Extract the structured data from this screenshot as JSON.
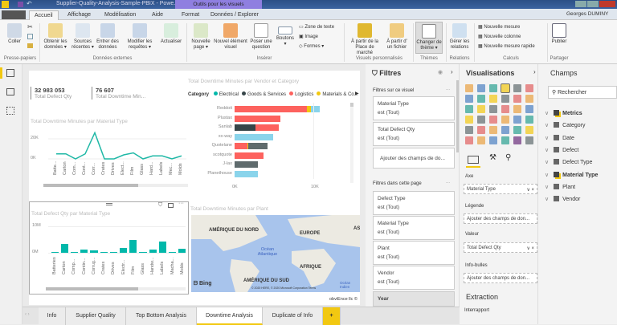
{
  "window": {
    "title": "Supplier-Quality-Analysis-Sample-PBIX - Powe...",
    "context_tab": "Outils pour les visuels",
    "user": "Georges DUMINY"
  },
  "ribbon_tabs": [
    "Accueil",
    "Affichage",
    "Modélisation",
    "Aide",
    "Format",
    "Données / Explorer"
  ],
  "ribbon": {
    "paste": "Coller",
    "clipboard_group": "Presse-papiers",
    "get_data": "Obtenir les données ▾",
    "recent": "Sources récentes ▾",
    "enter": "Entrer des données",
    "edit_queries": "Modifier les requêtes ▾",
    "refresh": "Actualiser",
    "external_group": "Données externes",
    "new_page": "Nouvelle page ▾",
    "new_visual": "Nouvel élément visuel",
    "ask": "Poser une question",
    "buttons": "Boutons ▾",
    "textbox": "Zone de texte",
    "image": "Image",
    "shapes": "Formes ▾",
    "insert_group": "Insérer",
    "marketplace": "À partir de la Place de marché",
    "from_file": "À partir d' un fichier",
    "custom_group": "Visuels personnalisés",
    "theme": "Changer de thème ▾",
    "themes_group": "Thèmes",
    "relations": "Gérer les relations",
    "relations_group": "Relations",
    "new_measure": "Nouvelle mesure",
    "new_column": "Nouvelle colonne",
    "quick_measure": "Nouvelle mesure rapide",
    "calc_group": "Calculs",
    "publish": "Publier",
    "share_group": "Partager"
  },
  "kpis": [
    {
      "value": "32 983 053",
      "label": "Total Defect Qty"
    },
    {
      "value": "76 607",
      "label": "Total Downtime Min..."
    }
  ],
  "chart_data": [
    {
      "type": "line",
      "title": "Total Downtime Minutes par Material Type",
      "categories": [
        "Batte...",
        "Carton",
        "Com...",
        "Cont...",
        "Corr...",
        "Crates",
        "Drives",
        "Elect...",
        "Film",
        "Glass",
        "Hard...",
        "Labels",
        "Mec...",
        "Molds"
      ],
      "values": [
        5000,
        5000,
        0,
        5000,
        26000,
        0,
        0,
        4000,
        6000,
        0,
        3000,
        3000,
        0,
        3000
      ],
      "yticks": [
        "0K",
        "20K"
      ],
      "ylim": [
        0,
        28000
      ],
      "color": "#1fb8a6"
    },
    {
      "type": "bar",
      "stacked": true,
      "orientation": "horizontal",
      "title": "Total Downtime Minutes par Vendor et Category",
      "legend_title": "Category",
      "legend": "top",
      "categories": [
        "Reddoit",
        "Plustax",
        "Sanlab",
        "xx-way",
        "Quotelane",
        "scotquote",
        "J-lax",
        "Planethouse"
      ],
      "series": [
        {
          "name": "Electrical",
          "color": "#01b8aa",
          "values": [
            0,
            0,
            0,
            0,
            0,
            0,
            0,
            0
          ]
        },
        {
          "name": "Goods & Services",
          "color": "#374649",
          "values": [
            0,
            0,
            2700,
            0,
            0,
            0,
            0,
            0
          ]
        },
        {
          "name": "Logistics",
          "color": "#fd625e",
          "values": [
            9200,
            5800,
            2900,
            0,
            1600,
            3700,
            0,
            0
          ]
        },
        {
          "name": "Materials & Co...",
          "color": "#f2c80f",
          "values": [
            500,
            0,
            0,
            0,
            100,
            0,
            0,
            0
          ]
        },
        {
          "color": "#5f6b6d",
          "values": [
            0,
            0,
            0,
            0,
            2500,
            0,
            3000,
            0
          ]
        },
        {
          "color": "#8ad4eb",
          "values": [
            1100,
            0,
            0,
            4900,
            0,
            0,
            0,
            3000
          ]
        }
      ],
      "xticks": [
        "0K",
        "10K"
      ],
      "xlim": [
        0,
        14000
      ]
    },
    {
      "type": "bar",
      "title": "Total Defect Qty par Material Type",
      "categories": [
        "Batteries",
        "Carton",
        "Comp...",
        "Contin...",
        "Corrug...",
        "Crates",
        "Drives",
        "Electr...",
        "Film",
        "Glass",
        "Handw...",
        "Labels",
        "Macha...",
        "Molds"
      ],
      "values": [
        0.4,
        3.4,
        0.4,
        1.1,
        0.8,
        0.1,
        0.4,
        1.8,
        4.7,
        0.1,
        1.1,
        4.2,
        0.1,
        1.6
      ],
      "unit": "M",
      "yticks": [
        "0M",
        "10M"
      ],
      "ylim": [
        0,
        12
      ],
      "color": "#01b8aa"
    }
  ],
  "map": {
    "title": "Total Downtime Minutes par Plant",
    "labels": [
      "AMÉRIQUE DU NORD",
      "EUROPE",
      "Océan Atlantique",
      "AFRIQUE",
      "AMÉRIQUE DU SUD",
      "AS",
      "Océan Indien"
    ],
    "bing": "Bing",
    "copyright": "© 2020 HERE, © 2020 Microsoft Corporation Terms"
  },
  "footer_credit": "obviEnce llc ©",
  "page_tabs": [
    "Info",
    "Supplier Quality",
    "Top Bottom Analysis",
    "Downtime Analysis",
    "Duplicate of Info"
  ],
  "active_page": "Downtime Analysis",
  "add_page": "+",
  "filters": {
    "title": "Filtres",
    "visual_section": "Filtres sur ce visuel",
    "visual_filters": [
      {
        "field": "Material Type",
        "value": "est (Tout)"
      },
      {
        "field": "Total Defect Qty",
        "value": "est (Tout)"
      }
    ],
    "add_fields": "Ajouter des champs de do...",
    "page_section": "Filtres dans cette page",
    "page_filters": [
      {
        "field": "Defect Type",
        "value": "est (Tout)"
      },
      {
        "field": "Material Type",
        "value": "est (Tout)"
      },
      {
        "field": "Plant",
        "value": "est (Tout)"
      },
      {
        "field": "Vendor",
        "value": "est (Tout)"
      }
    ],
    "year": "Year",
    "more": "..."
  },
  "visualizations": {
    "title": "Visualisations",
    "axis_label": "Axe",
    "axis_value": "Material Type",
    "legend_label": "Légende",
    "legend_placeholder": "Ajouter des champs de don...",
    "value_label": "Valeur",
    "value_value": "Total Defect Qty",
    "tooltip_label": "Info-bulles",
    "tooltip_placeholder": "Ajouter des champs de don...",
    "drill_title": "Extraction",
    "drill_cross": "Interrapport",
    "well_actions": "∨ ×"
  },
  "fields": {
    "title": "Champs",
    "search_placeholder": "Rechercher",
    "tables": [
      "Metrics",
      "Category",
      "Date",
      "Defect",
      "Defect Type",
      "Material Type",
      "Plant",
      "Vendor"
    ]
  },
  "colors": {
    "accent": "#f2c811",
    "teal": "#01b8aa",
    "titlebar": "#2b4f86"
  }
}
